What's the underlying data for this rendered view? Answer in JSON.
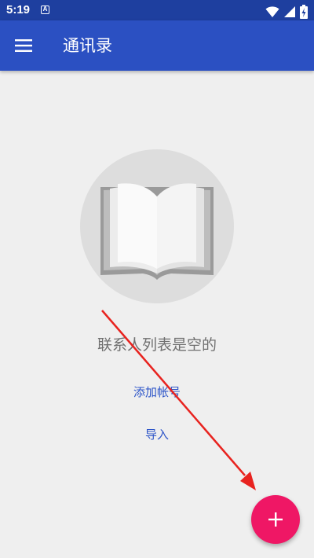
{
  "status_bar": {
    "time": "5:19",
    "notification_icon": "A"
  },
  "app_bar": {
    "title": "通讯录",
    "menu_icon": "menu-icon"
  },
  "empty_state": {
    "illustration_icon": "open-book-icon",
    "message": "联系人列表是空的",
    "add_account_label": "添加帐号",
    "import_label": "导入"
  },
  "fab": {
    "icon": "plus-icon"
  },
  "colors": {
    "status_bar": "#1e3f9f",
    "app_bar": "#2b50c2",
    "background": "#efefef",
    "link": "#2d55c8",
    "fab": "#ef1765",
    "annotation_arrow": "#e8231f"
  }
}
